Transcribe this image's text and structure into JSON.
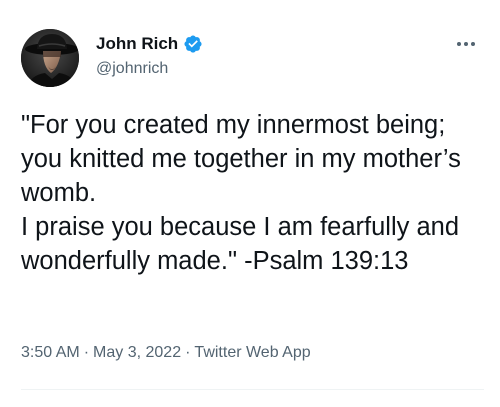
{
  "author": {
    "display_name": "John Rich",
    "handle": "@johnrich",
    "verified": true,
    "verified_color": "#1d9bf0",
    "avatar_icon": "profile-photo-cowboy-hat"
  },
  "menu": {
    "icon": "more-horizontal-icon"
  },
  "tweet": {
    "text": "\"For you created my innermost being; you knitted me together in my mother’s womb.\nI praise you because I am fearfully and wonderfully made.\" -Psalm 139:13"
  },
  "meta": {
    "time": "3:50 AM",
    "separator": "·",
    "date": "May 3, 2022",
    "source": "Twitter Web App"
  },
  "colors": {
    "text_primary": "#0f1419",
    "text_secondary": "#536471",
    "divider": "#eff3f4"
  }
}
